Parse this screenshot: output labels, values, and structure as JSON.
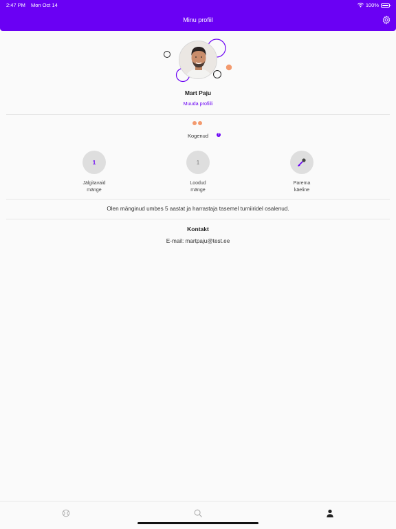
{
  "status_bar": {
    "time": "2:47 PM",
    "date": "Mon Oct 14",
    "battery": "100%"
  },
  "header": {
    "title": "Minu profiil",
    "settings_icon": "gear-icon"
  },
  "profile": {
    "name": "Mart Paju",
    "edit_label": "Muuda profiili",
    "level_label": "Kogenud",
    "level_info_icon": "question-icon",
    "level_info_text": "?"
  },
  "stats": [
    {
      "value": "1",
      "line1": "Jälgitavaid",
      "line2": "mänge"
    },
    {
      "value": "1",
      "line1": "Loodud",
      "line2": "mänge"
    },
    {
      "icon": "racket-icon",
      "line1": "Parema",
      "line2": "käeline"
    }
  ],
  "bio": "Olen mänginud umbes 5 aastat ja harrastaja tasemel turniiridel osalenud.",
  "contact": {
    "title": "Kontakt",
    "email": "E-mail: martpaju@test.ee"
  },
  "tabbar": {
    "items": [
      "games-icon",
      "search-icon",
      "profile-icon"
    ]
  },
  "colors": {
    "primary": "#6a00f4",
    "accent": "#f39a6e",
    "stat_bg": "#dedede"
  }
}
